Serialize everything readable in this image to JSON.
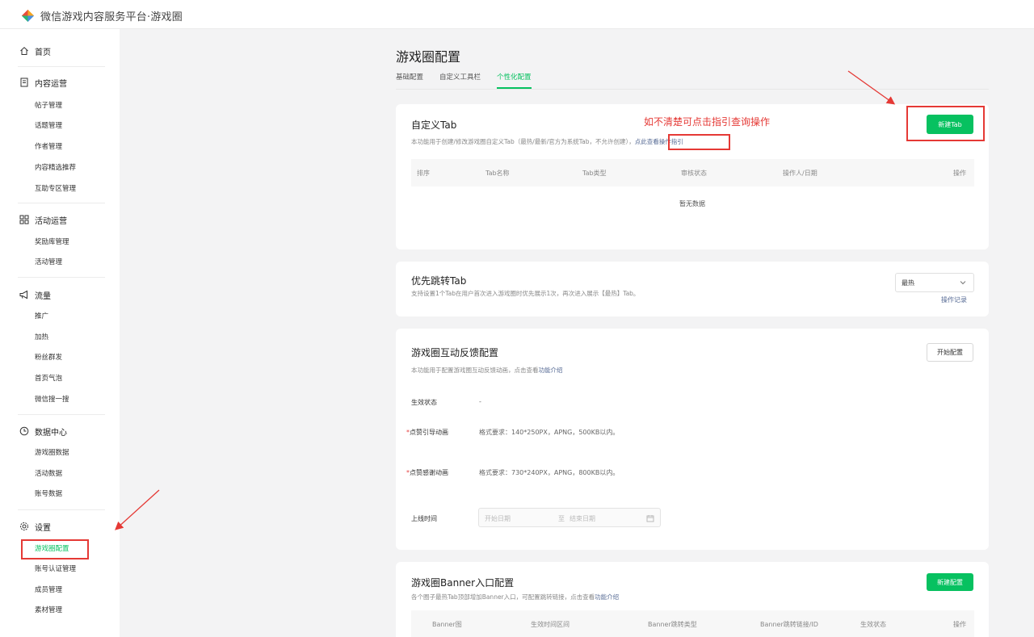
{
  "app": {
    "title": "微信游戏内容服务平台·游戏圈"
  },
  "sidebar": {
    "home": "首页",
    "groups": [
      {
        "label": "内容运营",
        "icon": "document-icon",
        "items": [
          "帖子管理",
          "话题管理",
          "作者管理",
          "内容精选推荐",
          "互助专区管理"
        ]
      },
      {
        "label": "活动运营",
        "icon": "grid-icon",
        "items": [
          "奖励库管理",
          "活动管理"
        ]
      },
      {
        "label": "流量",
        "icon": "megaphone-icon",
        "items": [
          "推广",
          "加热",
          "粉丝群发",
          "首页气泡",
          "微信搜一搜"
        ]
      },
      {
        "label": "数据中心",
        "icon": "clock-icon",
        "items": [
          "游戏圈数据",
          "活动数据",
          "账号数据"
        ]
      },
      {
        "label": "设置",
        "icon": "gear-icon",
        "items": [
          "游戏圈配置",
          "账号认证管理",
          "成员管理",
          "素材管理"
        ]
      }
    ],
    "active_item": "游戏圈配置"
  },
  "main": {
    "title": "游戏圈配置",
    "tabs": [
      "基础配置",
      "自定义工具栏",
      "个性化配置"
    ],
    "active_tab": "个性化配置"
  },
  "custom_tab": {
    "title": "自定义Tab",
    "desc": "本功能用于创建/修改游戏圈自定义Tab（最热/最新/官方为系统Tab，不允许创建），",
    "guide_link": "点此查看操作指引",
    "new_button": "新建Tab",
    "columns": [
      "排序",
      "Tab名称",
      "Tab类型",
      "审核状态",
      "操作人/日期",
      "操作"
    ],
    "empty": "暂无数据"
  },
  "priority_tab": {
    "title": "优先跳转Tab",
    "desc": "支持设置1个Tab在用户首次进入游戏圈时优先展示1次，再次进入展示【最热】Tab。",
    "select_value": "最热",
    "op_log": "操作记录"
  },
  "feedback": {
    "title": "游戏圈互动反馈配置",
    "desc": "本功能用于配置游戏圈互动反馈动画，点击查看",
    "desc_link": "功能介绍",
    "start_button": "开始配置",
    "status_label": "生效状态",
    "status_value": "-",
    "like_guide_label": "点赞引导动画",
    "like_guide_req": "格式要求：140*250PX，APNG，500KB以内。",
    "like_thanks_label": "点赞感谢动画",
    "like_thanks_req": "格式要求：730*240PX，APNG，800KB以内。",
    "online_time_label": "上线时间",
    "start_date_ph": "开始日期",
    "date_sep": "至",
    "end_date_ph": "结束日期",
    "required_mark": "*"
  },
  "banner": {
    "title": "游戏圈Banner入口配置",
    "desc": "各个圈子最热Tab顶部增加Banner入口，可配置跳转链接，点击查看",
    "desc_link": "功能介绍",
    "new_button": "新建配置",
    "columns": [
      "Banner图",
      "生效时间区间",
      "Banner跳转类型",
      "Banner跳转链接/ID",
      "生效状态",
      "操作"
    ]
  },
  "annotation": {
    "text": "如不清楚可点击指引查询操作",
    "color": "#e53935"
  },
  "colors": {
    "accent": "#07c160",
    "link": "#576b95",
    "annotation_red": "#e53935"
  }
}
